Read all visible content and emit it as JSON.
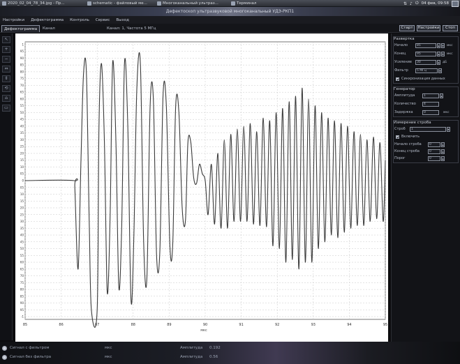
{
  "taskbar": {
    "tasks": [
      {
        "label": "2020_02_04_78_34.jpg - Пр..."
      },
      {
        "label": "schematic - файловый ме..."
      },
      {
        "label": "Многоканальный ультраз..."
      },
      {
        "label": "Терминал"
      }
    ],
    "clock": "04 фев, 09:58"
  },
  "window": {
    "title": "Дефектоскоп ультразвуковой многоканальный УДЭ-РКП1"
  },
  "menu": {
    "items": [
      "Настройки",
      "Дефектограмма",
      "Контроль",
      "Сервис",
      "Выход"
    ]
  },
  "tabs": {
    "active": "Дефектограмма",
    "items": [
      "Дефектограмма",
      "Канал"
    ],
    "channel_info": "Канал: 1, Частота 5 МГц"
  },
  "header_buttons": {
    "start": "Старт",
    "settings": "Настройки",
    "stop": "Стоп"
  },
  "left_tools": [
    "↖",
    "+",
    "−",
    "⇔",
    "⇕",
    "⟲",
    "⌂",
    "▭"
  ],
  "right_panel": {
    "group1": {
      "title": "Развертка",
      "rows": [
        {
          "label": "Начало",
          "value": "85",
          "unit": "мкс"
        },
        {
          "label": "Конец",
          "value": "95",
          "unit": "мкс"
        },
        {
          "label": "Усиление",
          "value": "30",
          "unit": "дБ"
        },
        {
          "label": "Фильтр",
          "value": "5 МГц",
          "unit": ""
        }
      ],
      "checkbox": "Синхронизация данных"
    },
    "group2": {
      "title": "Генератор",
      "rows": [
        {
          "label": "Амплитуда",
          "value": "1",
          "unit": ""
        },
        {
          "label": "Количество",
          "value": "4",
          "unit": ""
        },
        {
          "label": "Задержка",
          "value": "0",
          "unit": "мкс"
        }
      ]
    },
    "group3": {
      "title": "Измерение строба",
      "select": {
        "label": "Строб",
        "value": "1"
      },
      "checkbox": "Включить",
      "rows": [
        {
          "label": "Начало строба",
          "value": "0"
        },
        {
          "label": "Конец строба",
          "value": "0"
        },
        {
          "label": "Порог",
          "value": "0"
        }
      ]
    }
  },
  "status": {
    "row1": {
      "label": "Сигнал с фильтром",
      "value": "мкс",
      "amp_label": "Амплитуда",
      "amp_value": "0.192"
    },
    "row2": {
      "label": "Сигнал без фильтра",
      "value": "мкс",
      "amp_label": "Амплитуда",
      "amp_value": "0.56"
    }
  },
  "chart_data": {
    "type": "line",
    "xlabel": "мкс",
    "xlim": [
      85,
      95
    ],
    "x_ticks": [
      85,
      86,
      87,
      88,
      89,
      90,
      91,
      92,
      93,
      94,
      95
    ],
    "ylim": [
      -1.02,
      1.02
    ],
    "y_ticks": [
      1.0,
      0.95,
      0.9,
      0.85,
      0.8,
      0.75,
      0.7,
      0.65,
      0.6,
      0.55,
      0.5,
      0.45,
      0.4,
      0.35,
      0.3,
      0.25,
      0.2,
      0.15,
      0.1,
      0.05,
      0,
      -0.05,
      -0.1,
      -0.15,
      -0.2,
      -0.25,
      -0.3,
      -0.35,
      -0.4,
      -0.45,
      -0.5,
      -0.55,
      -0.6,
      -0.65,
      -0.7,
      -0.75,
      -0.8,
      -0.85,
      -0.9,
      -0.95,
      -1.0
    ],
    "y_tick_labels": [
      "1",
      "95",
      "90",
      "85",
      "80",
      "75",
      "70",
      "65",
      "60",
      "55",
      "50",
      "45",
      "40",
      "35",
      "30",
      "25",
      "20",
      "15",
      "10",
      "05",
      "0",
      "05",
      "10",
      "15",
      "20",
      "25",
      "30",
      "35",
      "40",
      "45",
      "50",
      "55",
      "60",
      "65",
      "70",
      "75",
      "80",
      "85",
      "90",
      "95",
      "-1"
    ],
    "grid": true,
    "series": [
      {
        "color": "#3a3a3a",
        "points": [
          [
            85.0,
            0.0
          ],
          [
            86.35,
            0.0
          ],
          [
            86.38,
            -0.05
          ],
          [
            86.47,
            -0.65
          ],
          [
            86.55,
            0.15
          ],
          [
            86.62,
            0.78
          ],
          [
            86.7,
            0.8
          ],
          [
            86.78,
            -0.3
          ],
          [
            86.84,
            -0.95
          ],
          [
            87.0,
            -0.95
          ],
          [
            87.05,
            0.4
          ],
          [
            87.12,
            0.86
          ],
          [
            87.2,
            0.3
          ],
          [
            87.28,
            -0.82
          ],
          [
            87.36,
            -0.25
          ],
          [
            87.43,
            0.87
          ],
          [
            87.52,
            0.3
          ],
          [
            87.6,
            -0.78
          ],
          [
            87.68,
            -0.35
          ],
          [
            87.76,
            0.87
          ],
          [
            87.85,
            0.4
          ],
          [
            87.94,
            -0.88
          ],
          [
            88.02,
            -0.4
          ],
          [
            88.1,
            0.67
          ],
          [
            88.2,
            0.86
          ],
          [
            88.29,
            -0.45
          ],
          [
            88.38,
            -0.72
          ],
          [
            88.47,
            0.55
          ],
          [
            88.56,
            0.6
          ],
          [
            88.65,
            -0.55
          ],
          [
            88.74,
            -0.52
          ],
          [
            88.83,
            0.63
          ],
          [
            88.92,
            0.55
          ],
          [
            89.02,
            -0.48
          ],
          [
            89.1,
            -0.45
          ],
          [
            89.18,
            0.55
          ],
          [
            89.27,
            0.5
          ],
          [
            89.36,
            -0.2
          ],
          [
            89.45,
            -0.3
          ],
          [
            89.52,
            0.28
          ],
          [
            89.6,
            0.28
          ],
          [
            89.68,
            0.02
          ],
          [
            89.76,
            -0.02
          ],
          [
            89.84,
            0.12
          ],
          [
            89.92,
            0.05
          ],
          [
            90.0,
            0.0
          ],
          [
            90.08,
            -0.25
          ],
          [
            90.17,
            0.12
          ],
          [
            90.26,
            -0.32
          ],
          [
            90.35,
            0.2
          ],
          [
            90.44,
            -0.35
          ],
          [
            90.53,
            0.3
          ],
          [
            90.62,
            -0.35
          ],
          [
            90.71,
            0.34
          ],
          [
            90.8,
            -0.3
          ],
          [
            90.89,
            0.38
          ],
          [
            90.98,
            -0.3
          ],
          [
            91.07,
            0.4
          ],
          [
            91.16,
            -0.3
          ],
          [
            91.25,
            0.42
          ],
          [
            91.34,
            -0.32
          ],
          [
            91.43,
            0.36
          ],
          [
            91.52,
            -0.33
          ],
          [
            91.61,
            0.46
          ],
          [
            91.7,
            -0.34
          ],
          [
            91.79,
            0.44
          ],
          [
            91.88,
            -0.48
          ],
          [
            91.97,
            0.5
          ],
          [
            92.06,
            -0.5
          ],
          [
            92.15,
            0.53
          ],
          [
            92.24,
            -0.6
          ],
          [
            92.33,
            0.58
          ],
          [
            92.42,
            -0.58
          ],
          [
            92.51,
            0.62
          ],
          [
            92.6,
            -0.65
          ],
          [
            92.69,
            0.68
          ],
          [
            92.78,
            -0.6
          ],
          [
            92.87,
            0.6
          ],
          [
            92.96,
            -0.6
          ],
          [
            93.05,
            0.55
          ],
          [
            93.14,
            -0.5
          ],
          [
            93.23,
            0.5
          ],
          [
            93.32,
            -0.45
          ],
          [
            93.41,
            0.46
          ],
          [
            93.5,
            -0.4
          ],
          [
            93.59,
            0.44
          ],
          [
            93.68,
            -0.42
          ],
          [
            93.77,
            0.42
          ],
          [
            93.86,
            -0.38
          ],
          [
            93.95,
            0.4
          ],
          [
            94.04,
            -0.35
          ],
          [
            94.13,
            0.36
          ],
          [
            94.22,
            -0.33
          ],
          [
            94.31,
            0.34
          ],
          [
            94.4,
            -0.33
          ],
          [
            94.49,
            0.3
          ],
          [
            94.58,
            -0.3
          ],
          [
            94.67,
            0.32
          ],
          [
            94.76,
            -0.28
          ],
          [
            94.85,
            0.28
          ],
          [
            94.94,
            -0.3
          ],
          [
            95.0,
            0.15
          ]
        ]
      }
    ]
  }
}
